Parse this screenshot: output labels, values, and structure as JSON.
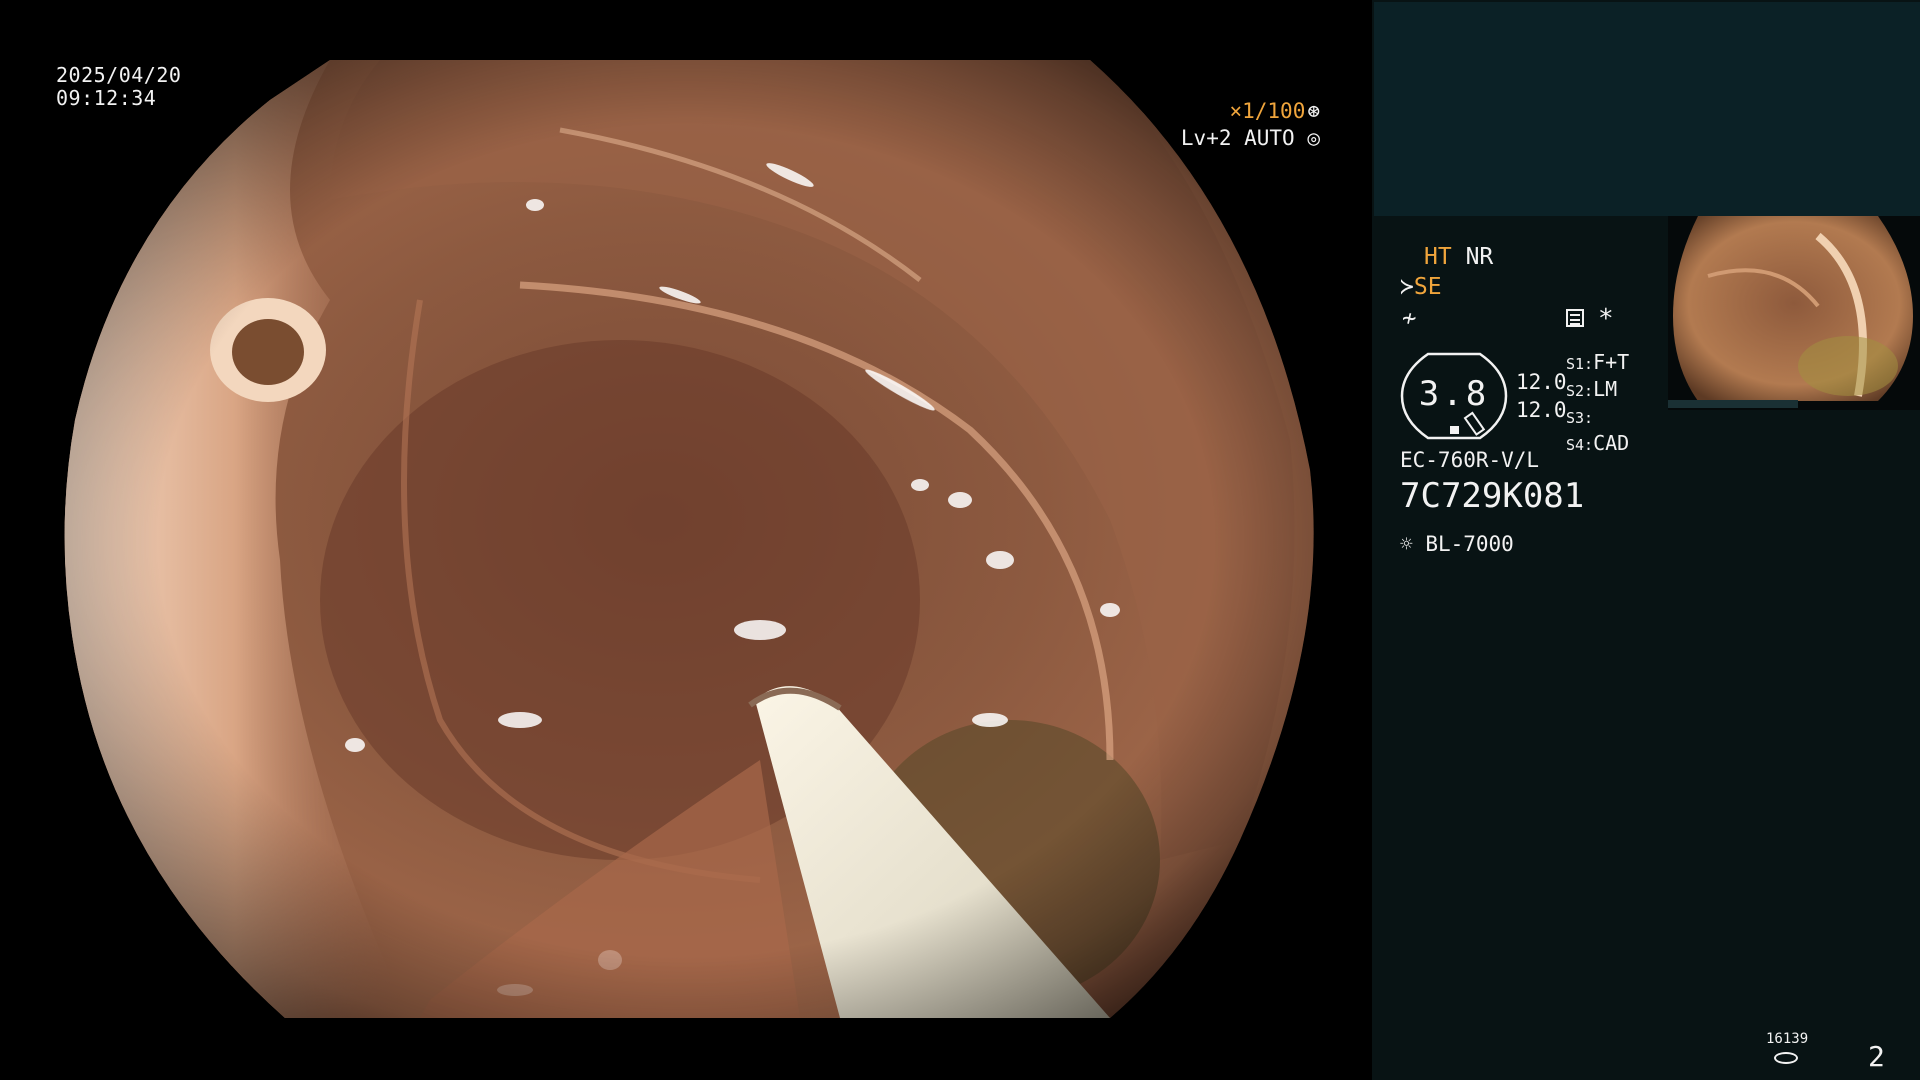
{
  "overlay": {
    "date": "2025/04/20",
    "time": "09:12:34",
    "shutter": "×1/100",
    "shutter_icon": "aperture-icon",
    "enhancement": "Lv+2 AUTO",
    "enhancement_icon": "auto-iris-icon"
  },
  "panel": {
    "ht": "HT",
    "nr": "NR",
    "se": "SE",
    "asterisk": "*",
    "gauge_value": "3.8",
    "gauge_values": [
      "12.0",
      "12.0"
    ],
    "switches": [
      {
        "key": "S1:",
        "value": "F+T"
      },
      {
        "key": "S2:",
        "value": "LM"
      },
      {
        "key": "S3:",
        "value": ""
      },
      {
        "key": "S4:",
        "value": "CAD"
      }
    ],
    "scope_model": "EC-760R-V/L",
    "serial": "7C729K081",
    "light_source": "BL-7000",
    "capture_count": "16139",
    "page_number": "2"
  },
  "colors": {
    "accent": "#f0a53c",
    "panel_bg": "#081314",
    "panel_top": "#0b2126",
    "tissue": "#8c5a3e"
  }
}
